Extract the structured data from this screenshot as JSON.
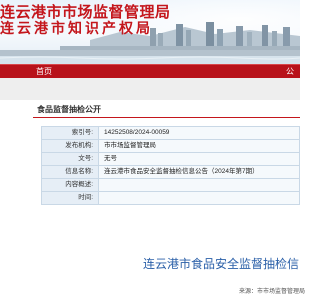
{
  "banner": {
    "title_line1": "连云港市市场监督管理局",
    "title_line2": "连云港市知识产权局"
  },
  "nav": {
    "items": [
      {
        "label": "首页"
      },
      {
        "label": "公开"
      }
    ]
  },
  "section": {
    "title": "食品监督抽检公开"
  },
  "meta": {
    "rows": [
      {
        "key": "索引号:",
        "value": "14252508/2024-00059"
      },
      {
        "key": "发布机构:",
        "value": "市市场监督管理局"
      },
      {
        "key": "文号:",
        "value": "无号"
      },
      {
        "key": "信息名称:",
        "value": "连云港市食品安全监督抽检信息公告（2024年第7期）"
      },
      {
        "key": "内容概述:",
        "value": ""
      },
      {
        "key": "时间:",
        "value": ""
      }
    ]
  },
  "document": {
    "title": "连云港市食品安全监督抽检信",
    "source_line": "来源：市市场监督管理局"
  },
  "colors": {
    "brand_red": "#c4161c",
    "nav_red": "#b8121a",
    "title_blue": "#2a5fa8",
    "table_key_bg": "#e6eef6",
    "table_border": "#c9d8e6"
  }
}
